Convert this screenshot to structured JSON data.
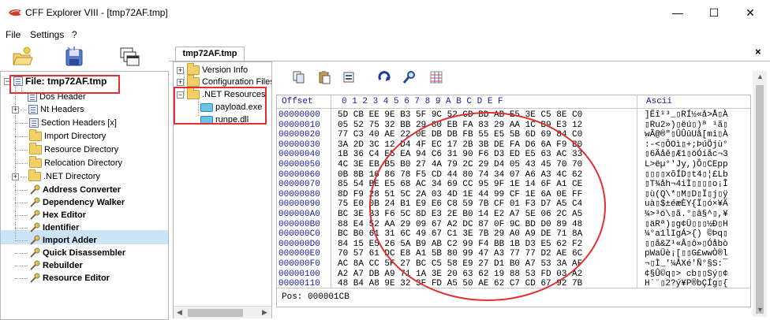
{
  "window": {
    "title": "CFF Explorer VIII - [tmp72AF.tmp]",
    "minimize_glyph": "—",
    "maximize_glyph": "☐",
    "close_glyph": "✕"
  },
  "menu": {
    "file": "File",
    "settings": "Settings",
    "help": "?"
  },
  "tree": {
    "root_label": "File: tmp72AF.tmp",
    "items": [
      {
        "label": "Dos Header",
        "icon": "doc-icon",
        "bold": false
      },
      {
        "label": "Nt Headers",
        "icon": "doc-icon",
        "bold": false
      },
      {
        "label": "Section Headers [x]",
        "icon": "doc-icon",
        "bold": false
      },
      {
        "label": "Import Directory",
        "icon": "folder-icon",
        "bold": false
      },
      {
        "label": "Resource Directory",
        "icon": "folder-icon",
        "bold": false
      },
      {
        "label": "Relocation Directory",
        "icon": "folder-icon",
        "bold": false
      },
      {
        "label": ".NET Directory",
        "icon": "folder-icon",
        "bold": false
      },
      {
        "label": "Address Converter",
        "icon": "tool-icon",
        "bold": true
      },
      {
        "label": "Dependency Walker",
        "icon": "tool-icon",
        "bold": true
      },
      {
        "label": "Hex Editor",
        "icon": "tool-icon",
        "bold": true
      },
      {
        "label": "Identifier",
        "icon": "tool-icon",
        "bold": true
      },
      {
        "label": "Import Adder",
        "icon": "tool-icon",
        "bold": true
      },
      {
        "label": "Quick Disassembler",
        "icon": "tool-icon",
        "bold": true
      },
      {
        "label": "Rebuilder",
        "icon": "tool-icon",
        "bold": true
      },
      {
        "label": "Resource Editor",
        "icon": "tool-icon",
        "bold": true
      }
    ]
  },
  "tab": {
    "label": "tmp72AF.tmp",
    "close_glyph": "×"
  },
  "resources": {
    "items": [
      {
        "label": "Version Info",
        "level": 0
      },
      {
        "label": "Configuration Files",
        "level": 0
      },
      {
        "label": ".NET Resources",
        "level": 0
      },
      {
        "label": "payload.exe",
        "level": 1
      },
      {
        "label": "runpe.dll",
        "level": 1
      }
    ]
  },
  "hex": {
    "offset_header": "Offset",
    "column_header": "0  1  2  3  4  5  6  7  8  9  A  B  C  D  E  F",
    "ascii_header": "Ascii",
    "rows": [
      {
        "offset": "00000000",
        "bytes": "5D CB EE 9E B3 5F 9C 52 CD BD AB E5 3E C5 8E C0",
        "ascii": "]Ëî¹³_▯RÍ½«å>Å▯À"
      },
      {
        "offset": "00000010",
        "bytes": "05 52 75 32 BB 29 80 EB FA 83 29 AA 1C B9 E3 12",
        "ascii": "▯Ru2»)▯ëú▯)ª ¹ã▯"
      },
      {
        "offset": "00000020",
        "bytes": "77 C3 40 AE 22 0E DB DB FB 55 E5 5B 6D 69 84 C0",
        "ascii": "wÃ@®\"▯ÛÛûUå[mi▯À"
      },
      {
        "offset": "00000030",
        "bytes": "3A 2D 3C 12 D4 4F EC 17 2B 3B DE FA D6 6A F9 B0",
        "ascii": ":-<▯ÔOì▯+;ÞúÖjù°"
      },
      {
        "offset": "00000040",
        "bytes": "1B 36 C4 E5 EA 94 C6 31 90 F6 D3 ED E5 63 AC 33",
        "ascii": "▯6Äåê▯Æ1▯öÓíåc¬3"
      },
      {
        "offset": "00000050",
        "bytes": "4C 3E EB B5 B0 27 4A 79 2C 29 D4 05 43 45 70 70",
        "ascii": "L>ëµ°'Jy,)Ô▯CEpp"
      },
      {
        "offset": "00000060",
        "bytes": "0B 8B 16 86 78 F5 CD 44 80 74 34 07 A6 A3 4C 62",
        "ascii": "▯▯▯▯xõÍD▯t4▯¦£Lb"
      },
      {
        "offset": "00000070",
        "bytes": "85 54 BE E5 68 AC 34 69 CC 95 9F 1E 14 6F A1 CE",
        "ascii": "▯T¾åh¬4iÌ▯▯▯▯o¡Î"
      },
      {
        "offset": "00000080",
        "bytes": "8D F9 28 51 5C 2A 03 4D 1E 44 99 CF 1E 6A 0E FF",
        "ascii": "▯ù(Q\\*▯M▯D▯Ï▯j▯ÿ"
      },
      {
        "offset": "00000090",
        "bytes": "75 E0 0B 24 B1 E9 E6 C8 59 7B CF 01 F3 D7 A5 C4",
        "ascii": "uà▯$±éæÈY{Ï▯ó×¥Ä"
      },
      {
        "offset": "000000A0",
        "bytes": "BC 3E B3 F6 5C 8D E3 2E B0 14 E2 A7 5E 06 2C A5",
        "ascii": "¼>³ö\\▯ã.°▯â§^▯,¥"
      },
      {
        "offset": "000000B0",
        "bytes": "88 E4 52 AA 29 09 67 A2 DC 87 0F 9C BD D0 89 48",
        "ascii": "▯äRª)▯g¢Ü▯▯▯½Ð▯H"
      },
      {
        "offset": "000000C0",
        "bytes": "BC B0 61 31 6C 49 67 C1 3E 7B 29 A0 A9 DE 71 8A",
        "ascii": "¼°a1lIgÁ>{) ©Þq▯"
      },
      {
        "offset": "000000D0",
        "bytes": "84 15 E5 26 5A B9 AB C2 99 F4 BB 1B D3 E5 62 F2",
        "ascii": "▯▯å&Z¹«Â▯ô»▯Óåbò"
      },
      {
        "offset": "000000E0",
        "bytes": "70 57 61 DC E8 A1 5B 80 99 47 A3 77 77 D2 AE 6C",
        "ascii": "pWaÜè¡[▯▯G£wwÒ®l"
      },
      {
        "offset": "000000F0",
        "bytes": "AC 8A CC 5F 27 BC C5 58 E9 27 D1 B0 A7 53 3A AF",
        "ascii": "¬▯Ì_'¼ÅXé'Ñ°§S:¯"
      },
      {
        "offset": "00000100",
        "bytes": "A2 A7 DB A9 71 1A 3E 20 63 62 19 88 53 FD 03 A2",
        "ascii": "¢§Û©q▯> cb▯▯Sý▯¢"
      },
      {
        "offset": "00000110",
        "bytes": "48 B4 A8 9E 32 3F FD A5 50 AE 62 C7 CD 67 92 7B",
        "ascii": "H´¨▯2?ý¥P®bÇÍg▯{"
      }
    ],
    "position_label": "Pos:",
    "position_value": "000001CB"
  },
  "annotation_color": "#e03030",
  "selection_color": "#cce4f7"
}
